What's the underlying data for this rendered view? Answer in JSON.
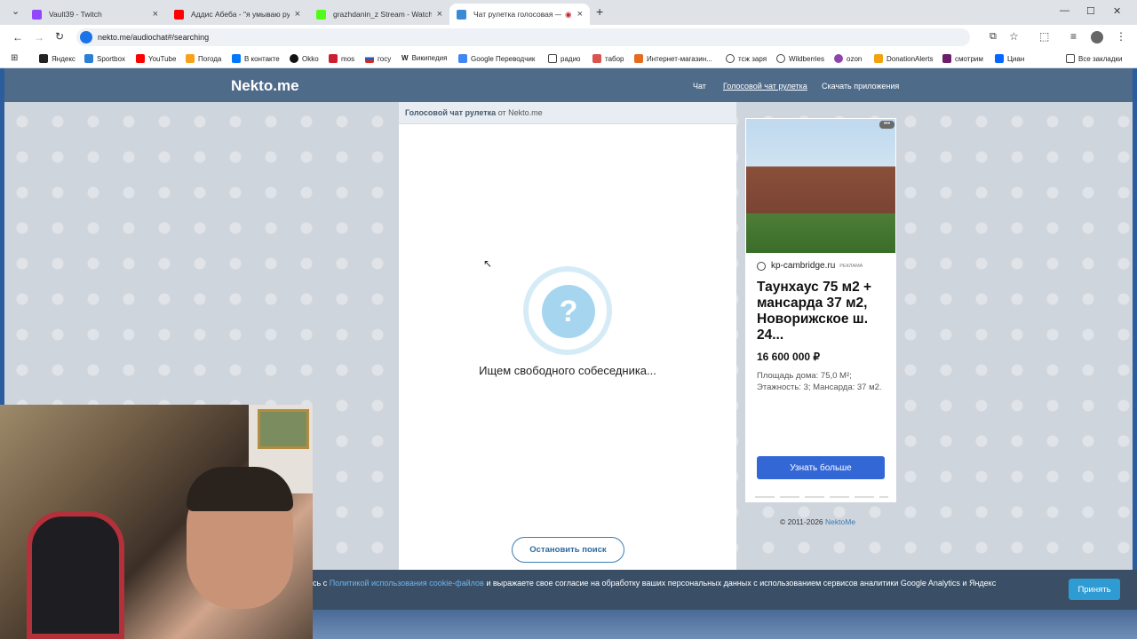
{
  "browser": {
    "tabs": [
      {
        "label": "Vault39 - Twitch",
        "color": "#9146ff"
      },
      {
        "label": "Аддис Абеба - \"я умываю рук",
        "color": "#ff0000"
      },
      {
        "label": "grazhdanin_z Stream - Watch L",
        "color": "#53fc18"
      },
      {
        "label": "Чат рулетка голосовая — ",
        "color": "#3a8ad6"
      }
    ],
    "new_tab": "+",
    "url": "nekto.me/audiochat#/searching",
    "bookmarks": [
      "Яндекс",
      "Sportbox",
      "YouTube",
      "Погода",
      "В контакте",
      "Okko",
      "mos",
      "госу",
      "Википедия",
      "Google Переводчик",
      "радио",
      "табор",
      "Интернет-магазин...",
      "тсж заря",
      "Wildberries",
      "ozon",
      "DonationAlerts",
      "смотрим",
      "Циан"
    ],
    "all_bookmarks": "Все закладки"
  },
  "site": {
    "logo": "Nekto.me",
    "nav": [
      "Чат",
      "Голосовой чат рулетка",
      "Скачать приложения"
    ],
    "chat_header_bold": "Голосовой чат рулетка",
    "chat_header_rest": "от Nekto.me",
    "searching_text": "Ищем свободного собеседника...",
    "question_mark": "?",
    "stop_button": "Остановить поиск",
    "copyright_text": "© 2011-2026",
    "copyright_link": "NektoMe"
  },
  "ad": {
    "more": "•••",
    "domain": "kp-cambridge.ru",
    "label": "РЕКЛАМА",
    "title": "Таунхаус 75 м2 + мансарда 37 м2, Новорижское ш. 24...",
    "price": "16 600 000 ₽",
    "description": "Площадь дома: 75,0 М²; Этажность: 3; Мансарда: 37 м2.",
    "button": "Узнать больше"
  },
  "cookie": {
    "prefix": "сь с ",
    "link": "Политикой использования cookie-файлов",
    "suffix": " и выражаете свое согласие на обработку ваших персональных данных с использованием сервисов аналитики Google Analytics и Яндекс",
    "accept": "Принять"
  }
}
